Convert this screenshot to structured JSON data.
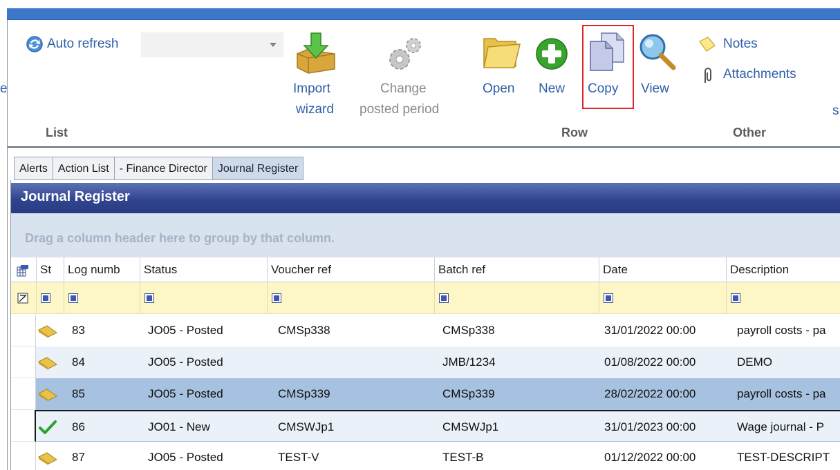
{
  "ribbon": {
    "auto_refresh_label": "Auto refresh",
    "edge_char": "e",
    "edge_char_right": "s",
    "import_wizard_line1": "Import",
    "import_wizard_line2": "wizard",
    "change_period_line1": "Change",
    "change_period_line2": "posted period",
    "open_label": "Open",
    "new_label": "New",
    "copy_label": "Copy",
    "view_label": "View",
    "notes_label": "Notes",
    "attachments_label": "Attachments",
    "group_list": "List",
    "group_row": "Row",
    "group_other": "Other"
  },
  "tabs": [
    {
      "label": "Alerts"
    },
    {
      "label": "Action List"
    },
    {
      "label": "- Finance Director"
    },
    {
      "label": "Journal Register"
    }
  ],
  "register": {
    "title": "Journal Register",
    "group_hint": "Drag a column header here to group by that column."
  },
  "columns": {
    "st": "St",
    "log": "Log numb",
    "status": "Status",
    "voucher": "Voucher ref",
    "batch": "Batch ref",
    "date": "Date",
    "description": "Description"
  },
  "rows": [
    {
      "icon": "posted-document-icon",
      "log": "83",
      "status": "JO05 - Posted",
      "voucher": "CMSp338",
      "batch": "CMSp338",
      "date": "31/01/2022 00:00",
      "description": "payroll costs - pa"
    },
    {
      "icon": "posted-document-icon",
      "log": "84",
      "status": "JO05 - Posted",
      "voucher": "",
      "batch": "JMB/1234",
      "date": "01/08/2022 00:00",
      "description": "DEMO"
    },
    {
      "icon": "posted-document-icon",
      "log": "85",
      "status": "JO05 - Posted",
      "voucher": "CMSp339",
      "batch": "CMSp339",
      "date": "28/02/2022 00:00",
      "description": "payroll costs - pa"
    },
    {
      "icon": "checkmark-icon",
      "log": "86",
      "status": "JO01 - New",
      "voucher": "CMSWJp1",
      "batch": "CMSWJp1",
      "date": "31/01/2023 00:00",
      "description": "Wage journal - P"
    },
    {
      "icon": "posted-document-icon",
      "log": "87",
      "status": "JO05 - Posted",
      "voucher": "TEST-V",
      "batch": "TEST-B",
      "date": "01/12/2022 00:00",
      "description": "TEST-DESCRIPT"
    }
  ],
  "colors": {
    "accent_blue": "#3d77c9",
    "header_navy": "#31458f",
    "selected_row": "#a7c1e0",
    "highlight_red": "#e0252b"
  }
}
